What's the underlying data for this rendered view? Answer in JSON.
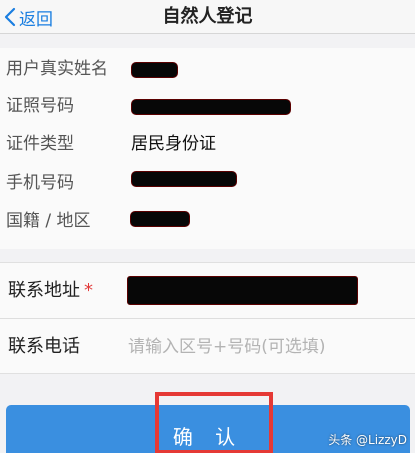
{
  "nav": {
    "back_label": "返回",
    "title": "自然人登记"
  },
  "info": {
    "rows": [
      {
        "label": "用户真实姓名",
        "value": ""
      },
      {
        "label": "证照号码",
        "value": ""
      },
      {
        "label": "证件类型",
        "value": "居民身份证"
      },
      {
        "label": "手机号码",
        "value": ""
      },
      {
        "label": "国籍 / 地区",
        "value": ""
      }
    ]
  },
  "form": {
    "address_label": "联系地址",
    "address_required_mark": "*",
    "phone_label": "联系电话",
    "phone_placeholder": "请输入区号+号码(可选填)"
  },
  "confirm_label": "确 认",
  "watermark": "头条 @LizzyD",
  "colors": {
    "accent": "#1a7ee0",
    "button": "#3a8fe0",
    "required": "#e23a3a",
    "highlight_box": "#e53935"
  },
  "icons": {
    "back": "chevron-left-icon"
  }
}
